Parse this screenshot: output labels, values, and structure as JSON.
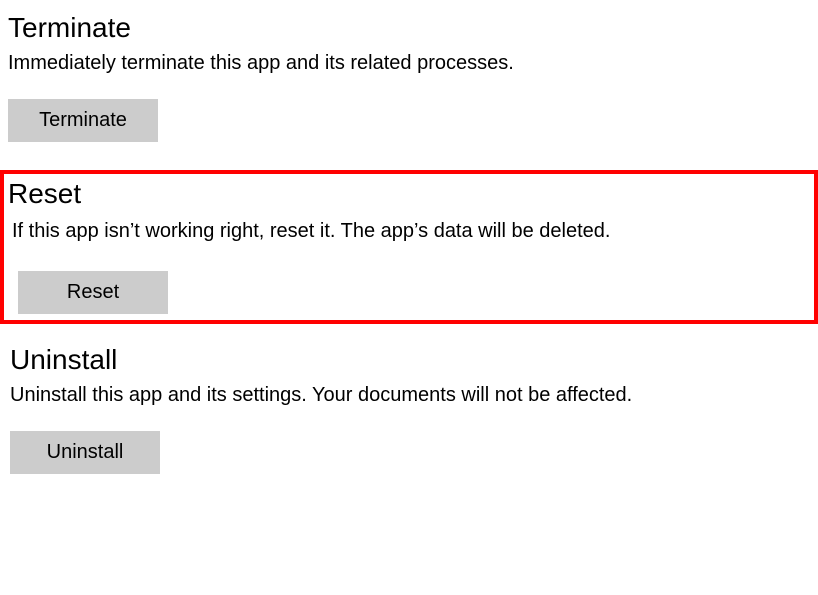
{
  "terminate": {
    "heading": "Terminate",
    "description": "Immediately terminate this app and its related processes.",
    "button_label": "Terminate"
  },
  "reset": {
    "heading": "Reset",
    "description": "If this app isn’t working right, reset it. The app’s data will be deleted.",
    "button_label": "Reset"
  },
  "uninstall": {
    "heading": "Uninstall",
    "description": "Uninstall this app and its settings. Your documents will not be affected.",
    "button_label": "Uninstall"
  }
}
